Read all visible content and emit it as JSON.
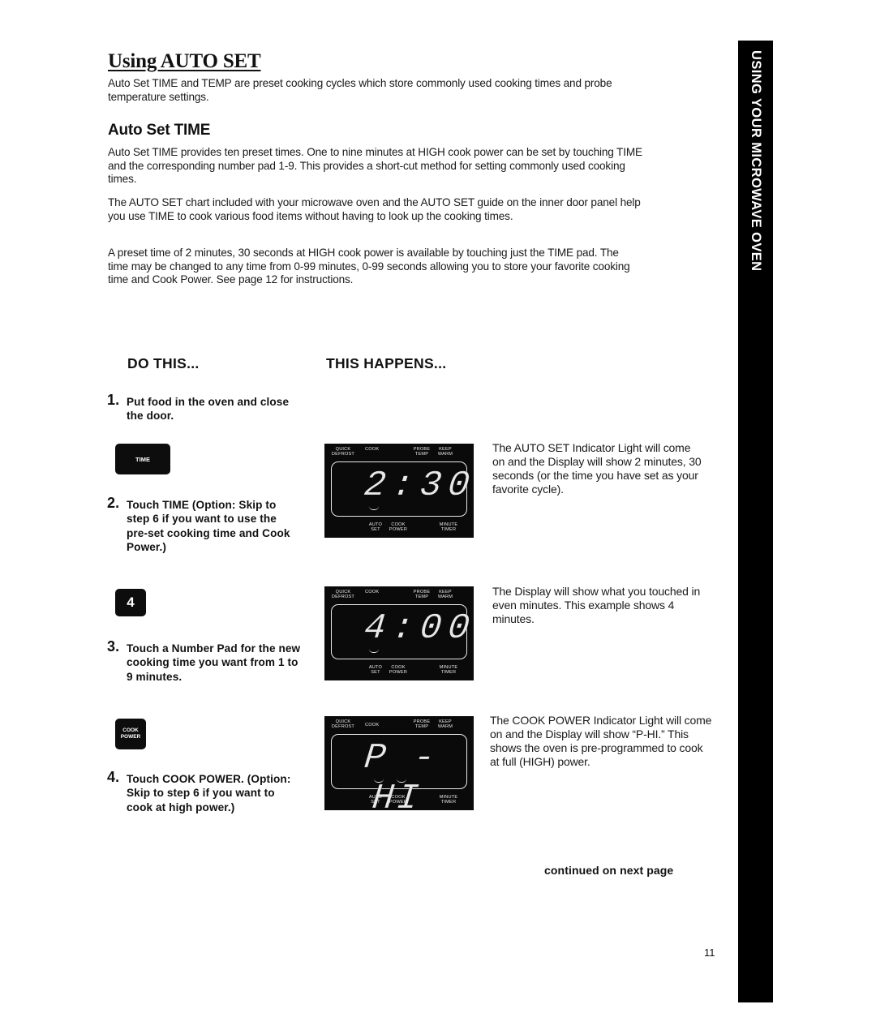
{
  "page": {
    "title": "Using AUTO SET",
    "intro": "Auto Set TIME and TEMP are preset cooking cycles which store commonly used cooking times and probe temperature settings.",
    "section_heading": "Auto Set TIME",
    "paragraphs": [
      "Auto Set TIME  provides ten preset times. One to nine minutes at HIGH cook power can be set by touching TIME and the corresponding number pad 1-9. This provides a short-cut method for setting commonly used cooking times.",
      "The AUTO SET chart included with your microwave oven and the AUTO SET guide on the inner door panel help you use TIME to cook various food items without having to look up the cooking times.",
      "A preset time of 2 minutes, 30 seconds at HIGH cook power is available by touching just the TIME pad. The time may be changed to any time from 0-99 minutes, 0-99 seconds allowing you to store your favorite cooking time and Cook Power. See page 12 for instructions."
    ],
    "side_tab": "USING YOUR MICROWAVE OVEN",
    "continued": "continued on next page",
    "page_number": "11"
  },
  "columns": {
    "do_this": "DO THIS...",
    "this_happens": "THIS HAPPENS..."
  },
  "display_labels": {
    "quick_defrost": "QUICK DEFROST",
    "cook": "COOK",
    "probe_temp": "PROBE TEMP",
    "keep_warm": "KEEP WARM",
    "auto_set": "AUTO SET",
    "cook_power": "COOK POWER",
    "minute_timer": "MINUTE TIMER"
  },
  "steps": [
    {
      "number": "1.",
      "text": "Put food in the oven and close the door."
    },
    {
      "number": "2.",
      "text": "Touch TIME (Option: Skip to step 6 if you want to use the pre-set cooking time and Cook Power.)",
      "pad": "TIME",
      "display": "2:30",
      "result": "The AUTO SET Indicator Light will come on and the Display will show 2 minutes, 30 seconds (or the time you have set as your favorite cycle)."
    },
    {
      "number": "3.",
      "text": "Touch a Number Pad for the new cooking time you want from 1 to 9 minutes.",
      "pad": "4",
      "display": "4:00",
      "result": "The Display will show what you touched in even minutes. This example shows 4 minutes."
    },
    {
      "number": "4.",
      "text": "Touch COOK POWER. (Option: Skip to step 6 if you want to cook at high power.)",
      "pad": "COOK POWER",
      "display": "P - HI",
      "result": "The COOK POWER Indicator Light will come on and the Display will show “P-HI.” This shows the oven is pre-programmed to cook at full (HIGH) power."
    }
  ]
}
